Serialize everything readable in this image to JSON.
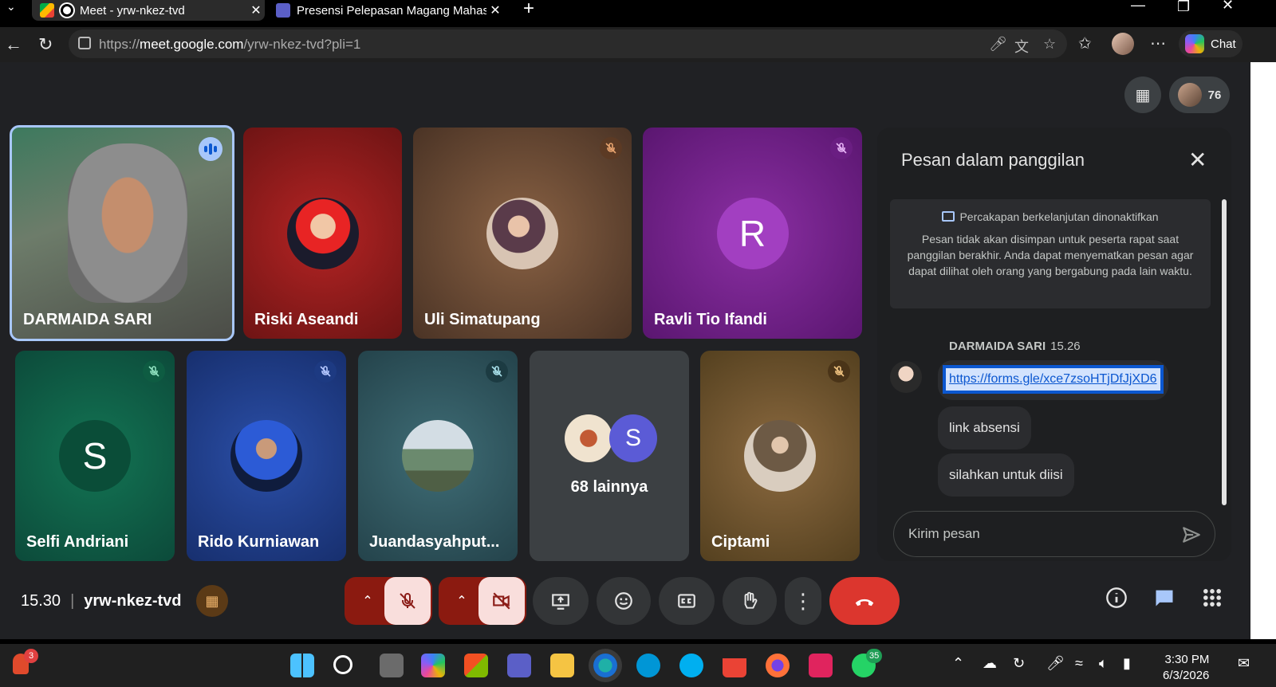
{
  "browser": {
    "tabs": [
      {
        "title": "Meet - yrw-nkez-tvd",
        "active": true
      },
      {
        "title": "Presensi Pelepasan Magang Mahasiswa",
        "active": false
      }
    ],
    "url_prefix": "https://",
    "url_domain": "meet.google.com",
    "url_path": "/yrw-nkez-tvd?pli=1",
    "chat_label": "Chat"
  },
  "meet": {
    "participant_count": "76",
    "tiles": [
      {
        "name": "DARMAIDA SARI",
        "speaking": true
      },
      {
        "name": "Riski Aseandi",
        "muted": false
      },
      {
        "name": "Uli Simatupang",
        "muted": true
      },
      {
        "name": "Ravli Tio Ifandi",
        "muted": true,
        "initial": "R"
      },
      {
        "name": "Selfi Andriani",
        "muted": true,
        "initial": "S"
      },
      {
        "name": "Rido Kurniawan",
        "muted": true
      },
      {
        "name": "Juandasyahput...",
        "muted": true
      },
      {
        "name": "Ciptami",
        "muted": true
      }
    ],
    "others": {
      "initial": "S",
      "label": "68 lainnya"
    },
    "time": "15.30",
    "meeting_code": "yrw-nkez-tvd"
  },
  "chat": {
    "title": "Pesan dalam panggilan",
    "notice_title": "Percakapan berkelanjutan dinonaktifkan",
    "notice_body": "Pesan tidak akan disimpan untuk peserta rapat saat panggilan berakhir. Anda dapat menyematkan pesan agar dapat dilihat oleh orang yang bergabung pada lain waktu.",
    "sender": "DARMAIDA SARI",
    "sent_time": "15.26",
    "messages": [
      {
        "text": "https://forms.gle/xce7zsoHTjDfJjXD6",
        "link": true
      },
      {
        "text": "link absensi"
      },
      {
        "text": "silahkan untuk diisi"
      }
    ],
    "compose_placeholder": "Kirim pesan"
  },
  "taskbar": {
    "notif_count": "3",
    "whatsapp_badge": "35",
    "clock_time": "3:30 PM",
    "clock_date": "6/3/2026"
  },
  "colors": {
    "end_call": "#dc362e",
    "muted_control_bg": "#f9dedc",
    "active_tile_border": "#a8c7fa"
  }
}
